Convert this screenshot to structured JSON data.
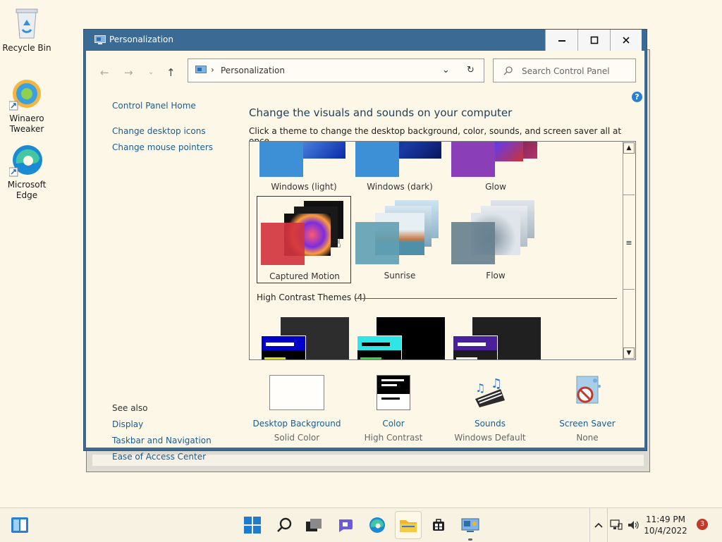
{
  "desktop": {
    "icons": [
      {
        "label": "Recycle Bin"
      },
      {
        "label": "Winaero Tweaker"
      },
      {
        "label": "Microsoft Edge"
      }
    ]
  },
  "window": {
    "title": "Personalization",
    "breadcrumb": "Personalization",
    "search_placeholder": "Search Control Panel",
    "help_glyph": "?"
  },
  "sidebar": {
    "links": [
      "Control Panel Home",
      "Change desktop icons",
      "Change mouse pointers"
    ],
    "see_also_label": "See also",
    "see_also": [
      "Display",
      "Taskbar and Navigation",
      "Ease of Access Center"
    ]
  },
  "main": {
    "heading": "Change the visuals and sounds on your computer",
    "subheading": "Click a theme to change the desktop background, color, sounds, and screen saver all at once.",
    "themes": [
      {
        "name": "Windows (light)"
      },
      {
        "name": "Windows (dark)"
      },
      {
        "name": "Glow"
      },
      {
        "name": "Captured Motion",
        "selected": true
      },
      {
        "name": "Sunrise"
      },
      {
        "name": "Flow"
      }
    ],
    "high_contrast_label": "High Contrast Themes (4)"
  },
  "bottom": [
    {
      "name": "Desktop Background",
      "value": "Solid Color"
    },
    {
      "name": "Color",
      "value": "High Contrast"
    },
    {
      "name": "Sounds",
      "value": "Windows Default"
    },
    {
      "name": "Screen Saver",
      "value": "None"
    }
  ],
  "taskbar": {
    "time": "11:49 PM",
    "date": "10/4/2022",
    "notifications": "3"
  },
  "colors": {
    "titlebar": "#3b6a94",
    "desktop": "#fcf7e6",
    "link": "#1a5c8f",
    "accent": "#2a7fd4"
  }
}
